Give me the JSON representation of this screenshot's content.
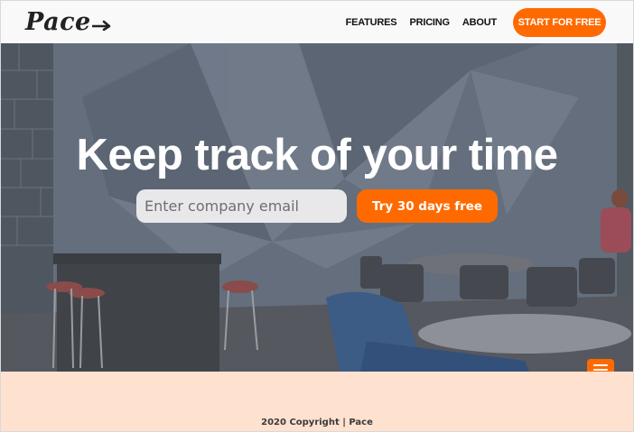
{
  "brand": {
    "name": "Pace",
    "logo_icon": "arrow-right-icon"
  },
  "nav": {
    "links": [
      "FEATURES",
      "PRICING",
      "ABOUT"
    ],
    "cta_label": "START FOR FREE"
  },
  "hero": {
    "title": "Keep track of your time",
    "email_placeholder": "Enter company email",
    "email_value": "",
    "try_label": "Try 30 days free",
    "menu_icon": "hamburger-menu-icon"
  },
  "footer": {
    "copyright": "2020 Copyright | Pace"
  },
  "colors": {
    "accent": "#ff6a00",
    "header_bg": "#f9f9f9",
    "hero_overlay": "#5d6775",
    "footer_bg": "#ffe1d0"
  }
}
